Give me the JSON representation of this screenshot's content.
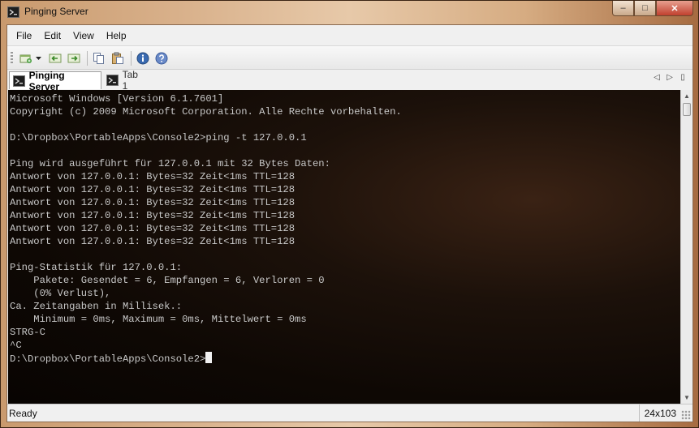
{
  "window": {
    "title": "Pinging Server"
  },
  "menu": {
    "items": [
      "File",
      "Edit",
      "View",
      "Help"
    ]
  },
  "toolbar": {
    "buttons": [
      {
        "name": "new-tab-button",
        "icon": "new-console-icon"
      },
      {
        "name": "new-tab-dropdown",
        "icon": "dropdown-arrow-icon"
      },
      {
        "name": "back-button",
        "icon": "arrow-left-icon"
      },
      {
        "name": "forward-button",
        "icon": "arrow-right-icon"
      },
      {
        "name": "copy-button",
        "icon": "copy-icon"
      },
      {
        "name": "paste-button",
        "icon": "paste-icon"
      },
      {
        "name": "info-button",
        "icon": "info-icon"
      },
      {
        "name": "help-button",
        "icon": "help-icon"
      }
    ]
  },
  "tabs": [
    {
      "label": "Pinging Server",
      "active": true
    },
    {
      "label": "Tab 1",
      "active": false
    }
  ],
  "console": {
    "lines": [
      "Microsoft Windows [Version 6.1.7601]",
      "Copyright (c) 2009 Microsoft Corporation. Alle Rechte vorbehalten.",
      "",
      "D:\\Dropbox\\PortableApps\\Console2>ping -t 127.0.0.1",
      "",
      "Ping wird ausgeführt für 127.0.0.1 mit 32 Bytes Daten:",
      "Antwort von 127.0.0.1: Bytes=32 Zeit<1ms TTL=128",
      "Antwort von 127.0.0.1: Bytes=32 Zeit<1ms TTL=128",
      "Antwort von 127.0.0.1: Bytes=32 Zeit<1ms TTL=128",
      "Antwort von 127.0.0.1: Bytes=32 Zeit<1ms TTL=128",
      "Antwort von 127.0.0.1: Bytes=32 Zeit<1ms TTL=128",
      "Antwort von 127.0.0.1: Bytes=32 Zeit<1ms TTL=128",
      "",
      "Ping-Statistik für 127.0.0.1:",
      "    Pakete: Gesendet = 6, Empfangen = 6, Verloren = 0",
      "    (0% Verlust),",
      "Ca. Zeitangaben in Millisek.:",
      "    Minimum = 0ms, Maximum = 0ms, Mittelwert = 0ms",
      "STRG-C",
      "^C"
    ],
    "prompt": "D:\\Dropbox\\PortableApps\\Console2>"
  },
  "status": {
    "text": "Ready",
    "size": "24x103"
  },
  "colors": {
    "console_text": "#c8c8c8",
    "console_bg": "#0e0804"
  }
}
